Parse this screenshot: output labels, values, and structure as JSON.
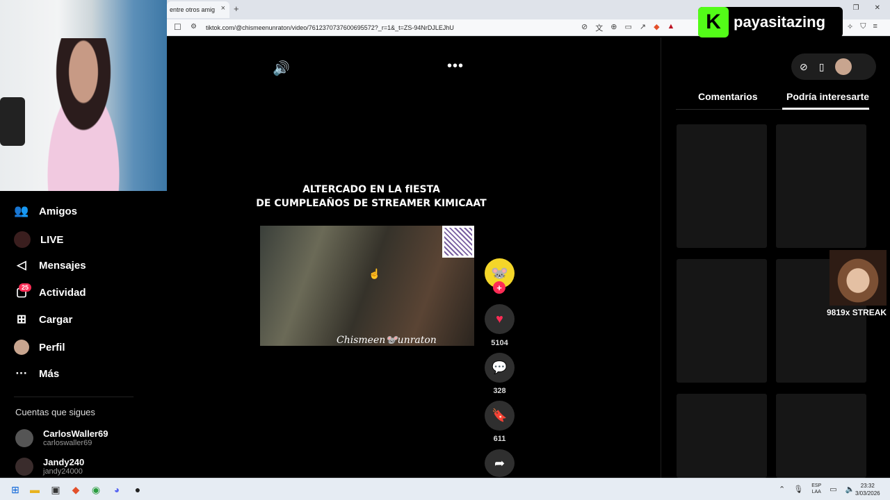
{
  "browser": {
    "tab_title": "entre otros amig",
    "tab_close": "×",
    "new_tab": "+",
    "url": "tiktok.com/@chismeenunraton/video/7612370737600695572?_r=1&_t=ZS-94NrDJLEJhU"
  },
  "overlay": {
    "kick_logo": "K",
    "kick_channel": "payasitazing",
    "streak_text": "9819x STREAK"
  },
  "sidebar": {
    "items": [
      {
        "label": "Amigos",
        "icon": "friends-icon"
      },
      {
        "label": "LIVE",
        "icon": "live-icon"
      },
      {
        "label": "Mensajes",
        "icon": "messages-icon"
      },
      {
        "label": "Actividad",
        "icon": "activity-icon",
        "badge": "25"
      },
      {
        "label": "Cargar",
        "icon": "upload-icon"
      },
      {
        "label": "Perfil",
        "icon": "profile-icon"
      },
      {
        "label": "Más",
        "icon": "more-icon"
      }
    ],
    "following_header": "Cuentas que sigues",
    "following": [
      {
        "name": "CarlosWaller69",
        "handle": "carloswaller69"
      },
      {
        "name": "Jandy240",
        "handle": "jandy24000"
      }
    ]
  },
  "video": {
    "title_line1": "ALTERCADO EN LA fIESTA",
    "title_line2": "DE CUMPLEAÑOS DE STREAMER KIMICAAT",
    "watermark": "Chismeen🐭unraton",
    "likes": "5104",
    "comments": "328",
    "saves": "611"
  },
  "right_panel": {
    "tab_comments": "Comentarios",
    "tab_related": "Podría interesarte",
    "active_tab": "Podría interesarte"
  },
  "taskbar": {
    "lang_line1": "ESP",
    "lang_line2": "LAA",
    "time": "23:32",
    "date": "3/03/2026"
  },
  "colors": {
    "tiktok_red": "#fe2c55",
    "kick_green": "#53fc18"
  }
}
